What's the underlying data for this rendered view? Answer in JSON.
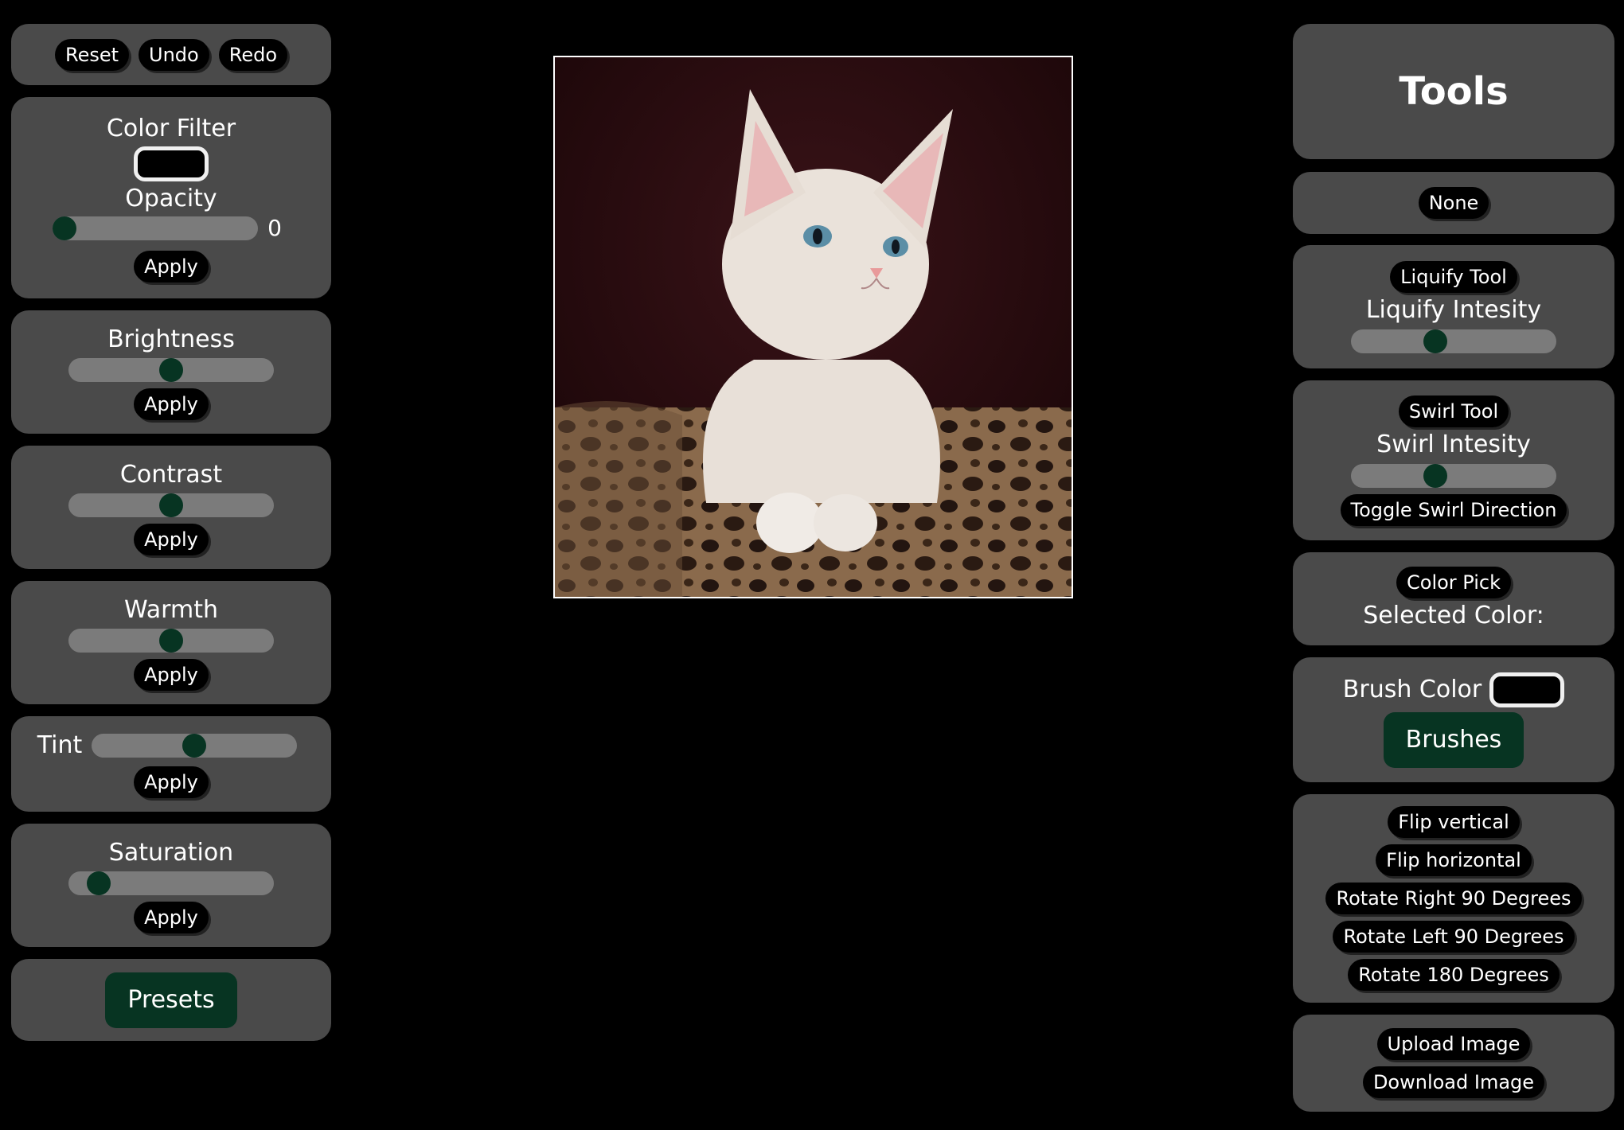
{
  "history": {
    "reset": "Reset",
    "undo": "Undo",
    "redo": "Redo"
  },
  "color_filter": {
    "title": "Color Filter",
    "color": "#000000",
    "opacity_label": "Opacity",
    "opacity_value": "0",
    "opacity_level": 0,
    "apply": "Apply"
  },
  "brightness": {
    "title": "Brightness",
    "level": 0.5,
    "apply": "Apply"
  },
  "contrast": {
    "title": "Contrast",
    "level": 0.5,
    "apply": "Apply"
  },
  "warmth": {
    "title": "Warmth",
    "level": 0.5,
    "apply": "Apply"
  },
  "tint": {
    "title": "Tint",
    "level": 0.5,
    "apply": "Apply"
  },
  "saturation": {
    "title": "Saturation",
    "level": 0.1,
    "apply": "Apply"
  },
  "presets": {
    "label": "Presets"
  },
  "tools": {
    "title": "Tools",
    "none": "None",
    "liquify": {
      "button": "Liquify Tool",
      "label": "Liquify Intesity",
      "level": 0.4
    },
    "swirl": {
      "button": "Swirl Tool",
      "label": "Swirl Intesity",
      "level": 0.4,
      "toggle": "Toggle Swirl Direction"
    },
    "color_pick": {
      "button": "Color Pick",
      "label": "Selected Color:"
    },
    "brush": {
      "label": "Brush Color",
      "color": "#000000",
      "brushes": "Brushes"
    },
    "transform": {
      "flip_vertical": "Flip vertical",
      "flip_horizontal": "Flip horizontal",
      "rotate_right": "Rotate Right 90 Degrees",
      "rotate_left": "Rotate Left 90 Degrees",
      "rotate_180": "Rotate 180 Degrees"
    },
    "file": {
      "upload": "Upload Image",
      "download": "Download Image"
    }
  },
  "colors": {
    "panel": "#4a4a4a",
    "accent": "#073422",
    "track": "#7b7b7b"
  }
}
